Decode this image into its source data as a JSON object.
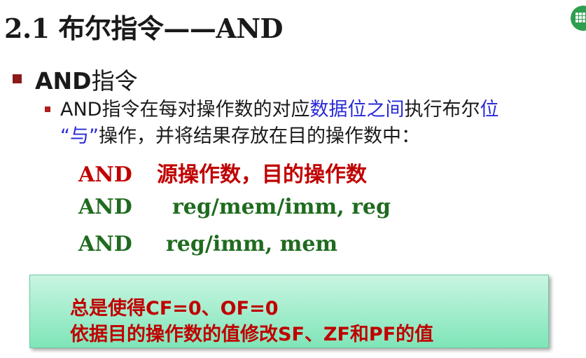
{
  "slide": {
    "title": "2.1 布尔指令——AND",
    "bullet_level1": {
      "latin": "AND",
      "cn": "指令"
    },
    "bullet_level2": {
      "line1_a": "AND指令在每对操作数的对应",
      "line1_b": "数据位之间",
      "line1_c": "执行布尔",
      "line1_d": "位",
      "line2_a": "“与”",
      "line2_b": "操作，并将结果存放在目的操作数中："
    },
    "syntax": [
      {
        "op": "AND",
        "args": "源操作数，目的操作数"
      },
      {
        "op": "AND",
        "args": "reg/mem/imm, reg"
      },
      {
        "op": "AND",
        "args": "reg/imm, mem"
      }
    ],
    "note": {
      "line1": "总是使得CF=0、OF=0",
      "line2": "依据目的操作数的值修改SF、ZF和PF的值"
    }
  },
  "colors": {
    "accent_red": "#c00000",
    "accent_green": "#1f6b1f",
    "accent_blue": "#2a2ad8",
    "note_bg": "#7fe5b8"
  },
  "icons": {
    "corner": "table-grid-icon"
  }
}
